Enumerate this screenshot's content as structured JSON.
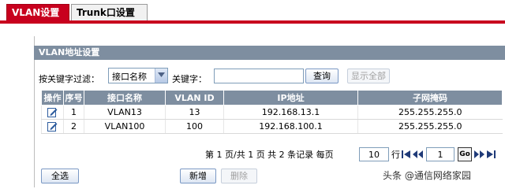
{
  "tabs": [
    {
      "label": "VLAN设置",
      "active": true
    },
    {
      "label": "Trunk口设置",
      "active": false
    }
  ],
  "section_title": "VLAN地址设置",
  "filter": {
    "label": "按关键字过滤：",
    "select_value": "接口名称",
    "keyword_label": "关键字：",
    "keyword_value": "",
    "query_button": "查询",
    "show_all_button": "显示全部"
  },
  "table": {
    "headers": [
      "操作",
      "序号",
      "接口名称",
      "VLAN ID",
      "IP地址",
      "子网掩码"
    ],
    "rows": [
      {
        "no": "1",
        "name": "VLAN13",
        "vlan_id": "13",
        "ip": "192.168.13.1",
        "mask": "255.255.255.0"
      },
      {
        "no": "2",
        "name": "VLAN100",
        "vlan_id": "100",
        "ip": "192.168.100.1",
        "mask": "255.255.255.0"
      }
    ]
  },
  "pager": {
    "text": "第 1 页/共 1 页 共 2 条记录 每页",
    "per_page": "10",
    "row_unit": "行",
    "page_input": "1",
    "go_label": "Go"
  },
  "actions": {
    "select_all": "全选",
    "add": "新增",
    "delete": "删除"
  },
  "watermark": "头条 @通信网络家园",
  "colors": {
    "accent": "#c8001e",
    "header": "#7e8ea0"
  }
}
